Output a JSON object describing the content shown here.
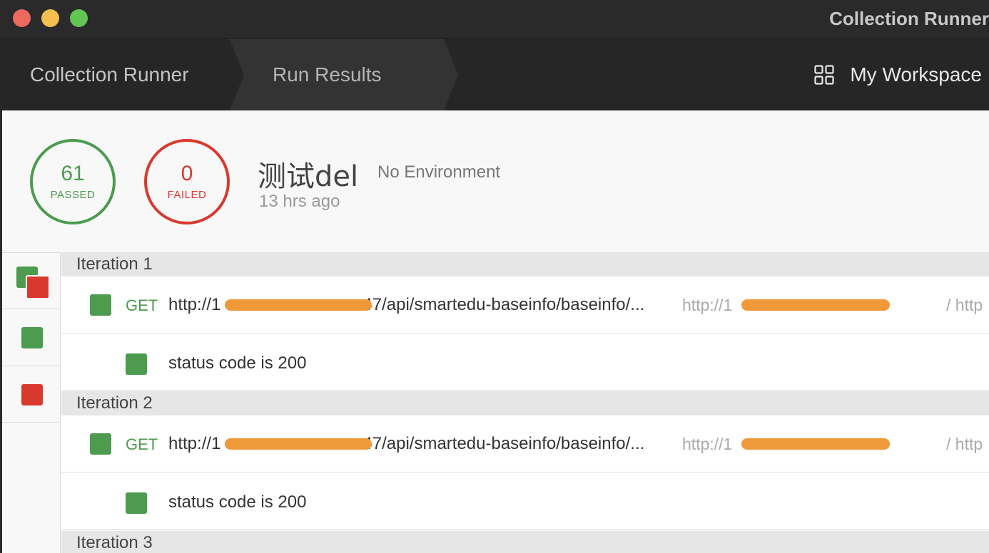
{
  "window": {
    "title": "Collection Runner"
  },
  "nav": {
    "breadcrumbs": [
      "Collection Runner",
      "Run Results"
    ],
    "workspace_label": "My Workspace",
    "workspace_icon": "grid-icon"
  },
  "summary": {
    "passed_count": "61",
    "passed_label": "PASSED",
    "failed_count": "0",
    "failed_label": "FAILED",
    "run_name": "测试del",
    "environment": "No Environment",
    "time_ago": "13 hrs ago"
  },
  "filters": [
    {
      "name": "all",
      "icon": "all-results-icon"
    },
    {
      "name": "passed",
      "icon": "passed-filter-icon"
    },
    {
      "name": "failed",
      "icon": "failed-filter-icon"
    }
  ],
  "colors": {
    "pass": "#4c9b4f",
    "fail": "#d9392d",
    "redaction": "#f0993b"
  },
  "iterations": [
    {
      "label": "Iteration 1",
      "request": {
        "method": "GET",
        "url_start": "http://1",
        "url_end": "47/api/smartedu-baseinfo/baseinfo/...",
        "url2_start": "http://1",
        "url2_end": ".",
        "url3": "/ http"
      },
      "test": "status code is 200"
    },
    {
      "label": "Iteration 2",
      "request": {
        "method": "GET",
        "url_start": "http://1",
        "url_end": "47/api/smartedu-baseinfo/baseinfo/...",
        "url2_start": "http://1",
        "url2_end": ".",
        "url3": "/ http"
      },
      "test": "status code is 200"
    },
    {
      "label": "Iteration 3"
    }
  ]
}
